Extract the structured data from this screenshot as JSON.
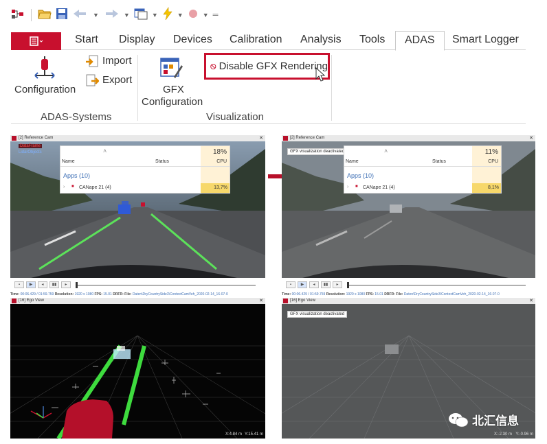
{
  "ribbon": {
    "tabs": [
      "Start",
      "Display",
      "Devices",
      "Calibration",
      "Analysis",
      "Tools",
      "ADAS",
      "Smart Logger"
    ],
    "active_tab": "ADAS",
    "groups": {
      "adas_systems": {
        "label": "ADAS-Systems",
        "configuration_label": "Configuration",
        "import_label": "Import",
        "export_label": "Export"
      },
      "visualization": {
        "label": "Visualization",
        "gfx_config_line1": "GFX",
        "gfx_config_line2": "Configuration",
        "disable_gfx_label": "Disable GFX Rendering"
      }
    },
    "highlight_color": "#c8102e"
  },
  "panels": {
    "left": {
      "reference_title": "[2] Reference Cam",
      "overlay_label_1": "DataFrame",
      "overlay_label_2": "LidarObjects",
      "cpu_total": "18%",
      "app_cpu": "13,7%",
      "ego_title": "[16] Ego View",
      "coord_x": "X:4.84 m",
      "coord_y": "Y:15.41 m"
    },
    "right": {
      "reference_title": "[2] Reference Cam",
      "gfx_notice": "GFX visualization deactivated",
      "cpu_total": "11%",
      "app_cpu": "8,1%",
      "ego_title": "[16] Ego View",
      "coord_x": "X:-2.30 m",
      "coord_y": "Y:-0.96 m"
    },
    "table": {
      "col_name": "Name",
      "col_status": "Status",
      "col_cpu": "CPU",
      "apps_group": "Apps (10)",
      "app_row": "CANape 21 (4)"
    },
    "status": {
      "time_label": "Time:",
      "time_value": "00:06.429 / 01:59.759",
      "res_label": "Resolution:",
      "res_value": "1920 x 1080",
      "fps_label": "FPS:",
      "fps_value": "15.01",
      "dfr_label": "DRFR:",
      "file_label": "File:",
      "file_value": "Daten\\DryCountrySide3\\ContextCamVeh_2020-02-14_16-07-0"
    }
  },
  "watermark": "北汇信息",
  "icons": [
    "network-icon",
    "open-folder-icon",
    "save-icon",
    "back-icon",
    "forward-icon",
    "window-icon",
    "lightning-icon",
    "record-icon",
    "menu-icon",
    "configuration-icon",
    "import-icon",
    "export-icon",
    "gfx-config-icon",
    "no-entry-icon",
    "cursor-icon",
    "arrow-icon",
    "wechat-icon"
  ]
}
